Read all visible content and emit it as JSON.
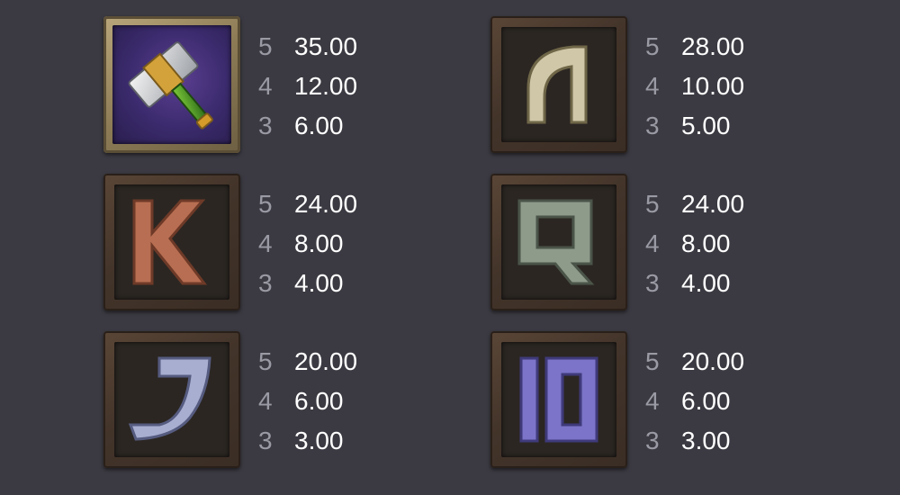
{
  "paytable": [
    {
      "symbol_icon": "hammer-icon",
      "pays": [
        {
          "count": "5",
          "amount": "35.00"
        },
        {
          "count": "4",
          "amount": "12.00"
        },
        {
          "count": "3",
          "amount": "6.00"
        }
      ]
    },
    {
      "symbol_icon": "rune-n-icon",
      "pays": [
        {
          "count": "5",
          "amount": "28.00"
        },
        {
          "count": "4",
          "amount": "10.00"
        },
        {
          "count": "3",
          "amount": "5.00"
        }
      ]
    },
    {
      "symbol_icon": "letter-k-icon",
      "pays": [
        {
          "count": "5",
          "amount": "24.00"
        },
        {
          "count": "4",
          "amount": "8.00"
        },
        {
          "count": "3",
          "amount": "4.00"
        }
      ]
    },
    {
      "symbol_icon": "letter-q-icon",
      "pays": [
        {
          "count": "5",
          "amount": "24.00"
        },
        {
          "count": "4",
          "amount": "8.00"
        },
        {
          "count": "3",
          "amount": "4.00"
        }
      ]
    },
    {
      "symbol_icon": "letter-j-icon",
      "pays": [
        {
          "count": "5",
          "amount": "20.00"
        },
        {
          "count": "4",
          "amount": "6.00"
        },
        {
          "count": "3",
          "amount": "3.00"
        }
      ]
    },
    {
      "symbol_icon": "number-10-icon",
      "pays": [
        {
          "count": "5",
          "amount": "20.00"
        },
        {
          "count": "4",
          "amount": "6.00"
        },
        {
          "count": "3",
          "amount": "3.00"
        }
      ]
    }
  ],
  "colors": {
    "background": "#3b3a42",
    "count_text": "#9a9aa4",
    "amount_text": "#ffffff"
  }
}
